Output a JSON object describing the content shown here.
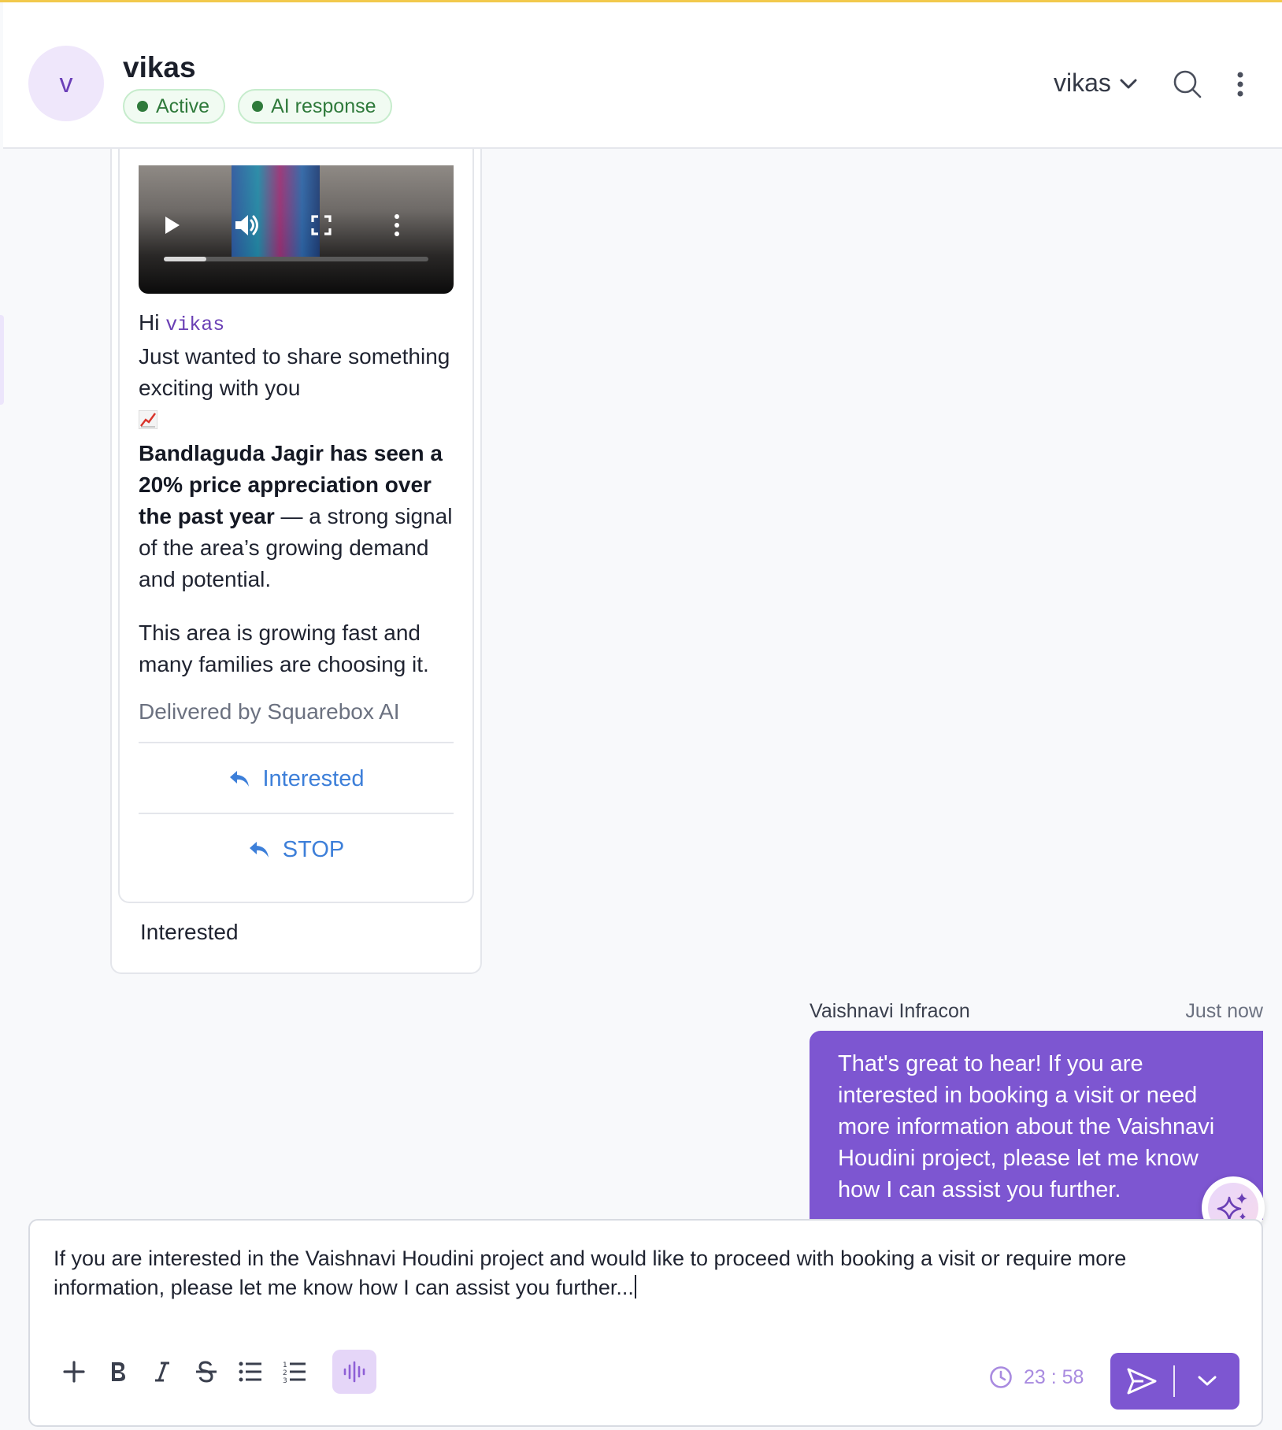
{
  "header": {
    "avatar_initial": "v",
    "contact_name": "vikas",
    "badges": [
      {
        "label": "Active"
      },
      {
        "label": "AI response"
      }
    ],
    "agent_name": "vikas",
    "status_color": "#2f7a3b"
  },
  "incoming": {
    "video": {
      "progress": 0.16
    },
    "greeting_prefix": "Hi",
    "greeting_name": "vikas",
    "line1": "Just wanted to share something exciting with you",
    "emoji_icon": "chart-increasing-icon",
    "bold_text": "Bandlaguda Jagir has seen a 20% price appreciation over the past year",
    "after_bold": " — a strong signal of the area’s growing demand and potential.",
    "para2": "This area is growing fast and many families are choosing it.",
    "delivered_by": "Delivered by Squarebox AI",
    "quick_replies": [
      {
        "label": "Interested"
      },
      {
        "label": "STOP"
      }
    ],
    "reply_text": "Interested"
  },
  "outgoing": {
    "sender": "Vaishnavi Infracon",
    "time": "Just now",
    "text": "That's great to hear! If you are interested in booking a visit or need more information about the Vaishnavi Houdini project, please let me know how I can assist you further.",
    "bubble_color": "#7d56d1"
  },
  "composer": {
    "text": "If you are interested in the Vaishnavi Houdini project and would like to proceed with booking a visit or require more information, please let me know how I can assist you further...",
    "timer": "23 : 58",
    "toolbar_icons": [
      "plus-icon",
      "bold-icon",
      "italic-icon",
      "strikethrough-icon",
      "bullet-list-icon",
      "numbered-list-icon",
      "voice-wave-icon"
    ]
  }
}
